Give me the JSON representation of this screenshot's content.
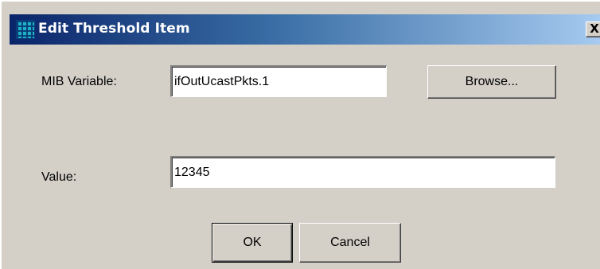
{
  "window": {
    "title": "Edit Threshold Item",
    "close_glyph": "X",
    "icon": "grid-app-icon"
  },
  "form": {
    "mib_variable": {
      "label": "MIB Variable:",
      "value": "ifOutUcastPkts.1"
    },
    "browse_label": "Browse...",
    "value_field": {
      "label": "Value:",
      "value": "12345"
    }
  },
  "buttons": {
    "ok": "OK",
    "cancel": "Cancel"
  },
  "colors": {
    "titlebar_start": "#0a246a",
    "titlebar_end": "#a6caf0",
    "dialog_face": "#d4d0c8"
  }
}
